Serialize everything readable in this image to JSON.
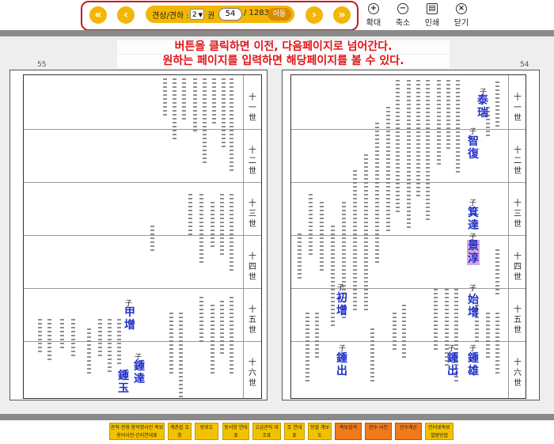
{
  "toolbar": {
    "first_icon": "«",
    "prev_icon": "‹",
    "next_icon": "›",
    "last_icon": "»",
    "volume_label": "권",
    "volume_value": "2",
    "volume_prefix": "견상/견하 :",
    "page_value": "54",
    "page_total": "/ 1283",
    "go_label": "이동",
    "zoom_in_label": "확대",
    "zoom_out_label": "축소",
    "print_label": "인쇄",
    "close_label": "닫기"
  },
  "annotation": {
    "line1": "버튼을 클릭하면 이전, 다음페이지로 넘어간다.",
    "line2": "원하는 페이지를 입력하면 해당페이지를 볼 수 있다."
  },
  "book": {
    "left_page_number": "55",
    "right_page_number": "54",
    "generations": [
      "十一世",
      "十二世",
      "十三世",
      "十四世",
      "十五世",
      "十六世"
    ],
    "left_names": [
      {
        "prefix": "子",
        "name": "甲增"
      },
      {
        "prefix": "子",
        "name": "鍾達"
      },
      {
        "prefix": "",
        "name": "鍾玉"
      }
    ],
    "right_names": [
      {
        "prefix": "子",
        "name": "泰瑞"
      },
      {
        "prefix": "子",
        "name": "智復"
      },
      {
        "prefix": "子",
        "name": "箕達"
      },
      {
        "prefix": "子",
        "name": "景淳"
      },
      {
        "prefix": "子",
        "name": "初增"
      },
      {
        "prefix": "子",
        "name": "始增"
      },
      {
        "prefix": "子",
        "name": "鍾出"
      },
      {
        "prefix": "子",
        "name": "鍾出"
      },
      {
        "prefix": "子",
        "name": "鍾雄"
      }
    ]
  },
  "footer": {
    "buttons": [
      {
        "label": "관직·관청·봉작명사전 족보용어사전·간지연대표"
      },
      {
        "label": "계촌법 호칭"
      },
      {
        "label": "방위도"
      },
      {
        "label": "동서양 연대표"
      },
      {
        "label": "고금관직 대조표"
      },
      {
        "label": "王 연대표"
      },
      {
        "label": "항렬 계보도"
      },
      {
        "label": "족보검색"
      },
      {
        "label": "관수·사진"
      },
      {
        "label": "관수계산"
      },
      {
        "label": "인터넷족보 열람방법"
      }
    ]
  },
  "colors": {
    "accent": "#f2b705",
    "annotation_red": "#e21419",
    "name_blue": "#2030c8",
    "highlight": "#d7a8dc"
  }
}
